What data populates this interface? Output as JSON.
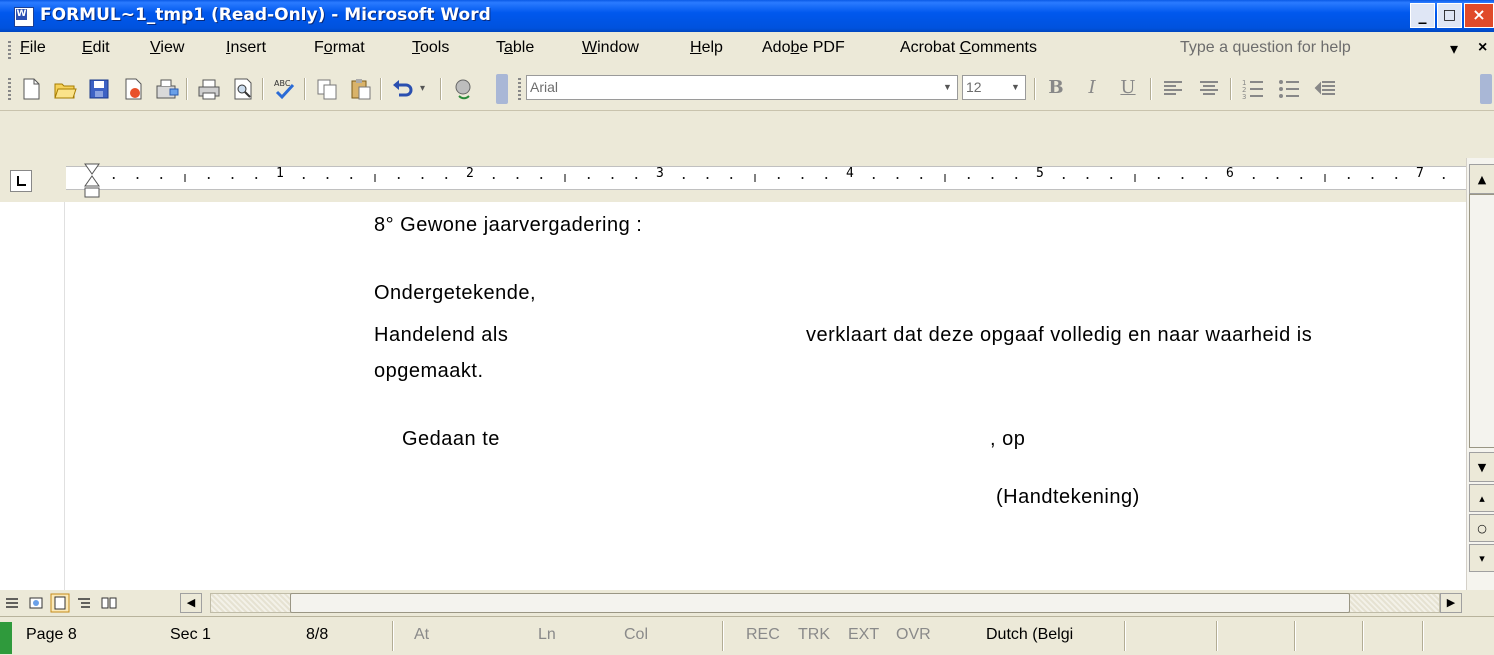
{
  "window": {
    "title": "FORMUL~1_tmp1 (Read-Only) - Microsoft Word",
    "minimize": "_",
    "maximize": "□",
    "close": "×"
  },
  "menu": {
    "items": [
      {
        "pre": "",
        "accel": "F",
        "post": "ile"
      },
      {
        "pre": "",
        "accel": "E",
        "post": "dit"
      },
      {
        "pre": "",
        "accel": "V",
        "post": "iew"
      },
      {
        "pre": "",
        "accel": "I",
        "post": "nsert"
      },
      {
        "pre": "F",
        "accel": "o",
        "post": "rmat"
      },
      {
        "pre": "",
        "accel": "T",
        "post": "ools"
      },
      {
        "pre": "T",
        "accel": "a",
        "post": "ble"
      },
      {
        "pre": "",
        "accel": "W",
        "post": "indow"
      },
      {
        "pre": "",
        "accel": "H",
        "post": "elp"
      },
      {
        "pre": "Ado",
        "accel": "b",
        "post": "e PDF"
      },
      {
        "pre": "Acrobat ",
        "accel": "C",
        "post": "omments"
      }
    ],
    "help_placeholder": "Type a question for help",
    "help_arrow": "▾",
    "doc_close": "×"
  },
  "toolbar": {
    "font_name": "Arial",
    "font_size": "12",
    "bold": "B",
    "italic": "I",
    "underline": "U",
    "icons": [
      "new-icon",
      "open-icon",
      "save-icon",
      "permission-icon",
      "print-icon",
      "print-preview-icon",
      "spelling-icon",
      "copy-icon",
      "paste-icon",
      "undo-icon",
      "ink-icon"
    ]
  },
  "ruler": {
    "labels": [
      "1",
      "2",
      "3",
      "4",
      "5",
      "6",
      "7"
    ]
  },
  "document": {
    "lines": [
      "8° Gewone jaarvergadering :",
      "Ondergetekende,",
      "Handelend als",
      "verklaart dat deze opgaaf volledig en naar waarheid is",
      "opgemaakt.",
      "Gedaan te",
      ", op",
      "(Handtekening)"
    ]
  },
  "status": {
    "page": "Page  8",
    "sec": "Sec  1",
    "pages": "8/8",
    "at": "At",
    "ln": "Ln",
    "col": "Col",
    "rec": "REC",
    "trk": "TRK",
    "ext": "EXT",
    "ovr": "OVR",
    "language": "Dutch (Belgi"
  },
  "colors": {
    "title_bar": "#0054e3",
    "chrome": "#ece9d8",
    "page": "#ffffff"
  }
}
